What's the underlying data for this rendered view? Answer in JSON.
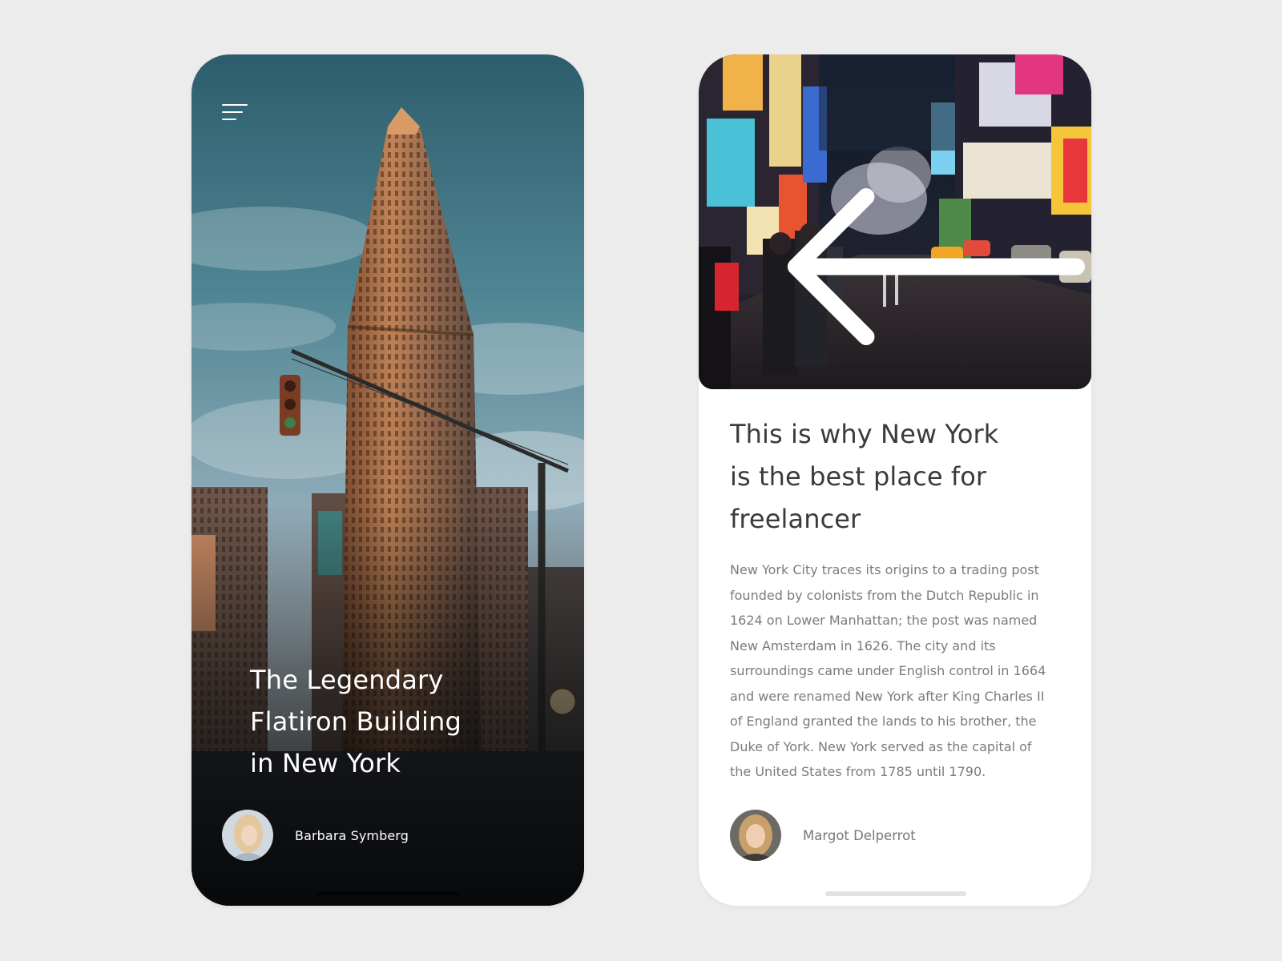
{
  "colors": {
    "background": "#ececec",
    "card_light": "#ffffff",
    "title_dark": "#3a3a3f",
    "body_text": "#7b7b80",
    "on_image_text": "#ffffff"
  },
  "screen_left": {
    "menu_icon": "hamburger-menu-icon",
    "title_lines": [
      "The Legendary",
      "Flatiron Building",
      "in New York"
    ],
    "author_name": "Barbara Symberg"
  },
  "screen_right": {
    "back_icon": "arrow-left-icon",
    "title_lines": [
      "This is why New York",
      "is the best place for",
      "freelancer"
    ],
    "body_lines": [
      "New York City traces its origins to a trading post",
      "founded by colonists from the Dutch Republic in",
      "1624 on Lower Manhattan; the post was named",
      "New Amsterdam in 1626. The city and its",
      "surroundings came under English control in 1664",
      "and were renamed New York after King Charles II",
      "of England granted the lands to his brother, the",
      "Duke of York. New York served as the capital of",
      "the United States from 1785 until 1790."
    ],
    "author_name": "Margot Delperrot"
  }
}
